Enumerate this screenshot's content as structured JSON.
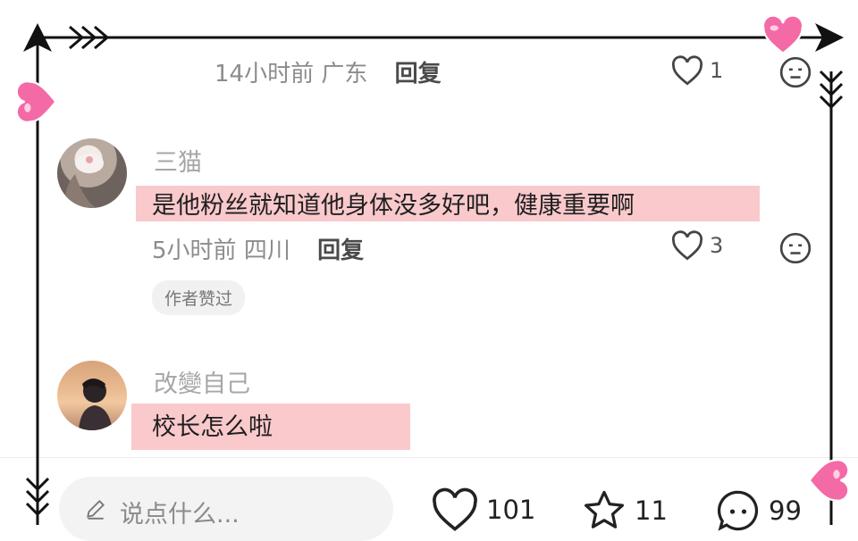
{
  "comments": [
    {
      "time": "14小时前",
      "location": "广东",
      "reply_label": "回复",
      "like_count": "1"
    },
    {
      "username": "三猫",
      "text": "是他粉丝就知道他身体没多好吧，健康重要啊",
      "time": "5小时前",
      "location": "四川",
      "reply_label": "回复",
      "like_count": "3",
      "badge": "作者赞过"
    },
    {
      "username": "改變自己",
      "text": "校长怎么啦"
    }
  ],
  "bottom_bar": {
    "input_placeholder": "说点什么...",
    "like_count": "101",
    "star_count": "11",
    "comment_count": "99"
  },
  "colors": {
    "highlight": "#f9c9cc",
    "heart_pink": "#f46aa6",
    "frame_line": "#111111"
  },
  "icons": [
    "heart-outline-icon",
    "neutral-face-icon",
    "pencil-icon",
    "star-outline-icon",
    "chat-bubble-icon",
    "pink-heart-sticker-icon",
    "arrow-frame-icon"
  ]
}
